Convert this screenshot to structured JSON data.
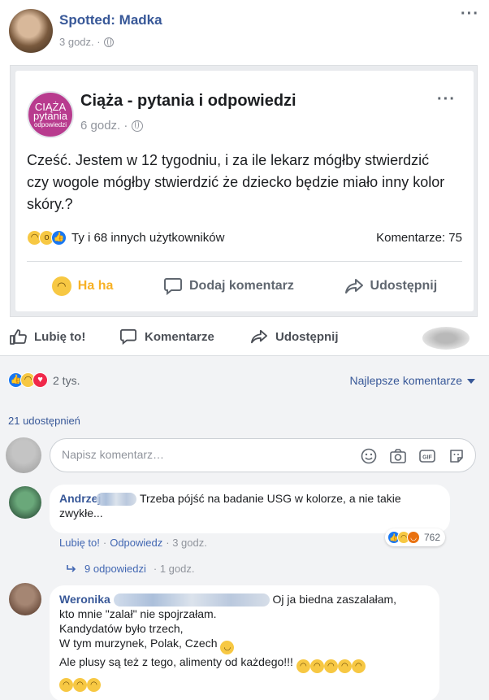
{
  "post": {
    "author": "Spotted: Madka",
    "time": "3 godz. ·",
    "menu_icon": "more-dots-icon"
  },
  "shared": {
    "group_avatar_lines": [
      "CIĄŻA",
      "pytania",
      "odpowiedzi"
    ],
    "group_name": "Ciąża - pytania i odpowiedzi",
    "time": "6 godz. ·",
    "question": "Cześć. Jestem w 12 tygodniu, i za ile lekarz mógłby stwierdzić czy wogole mógłby stwierdzić że dziecko będzie miało inny kolor skóry.?",
    "reactions_text": "Ty i 68 innych użytkowników",
    "comments_count": "Komentarze: 75",
    "actions": {
      "haha": "Ha ha",
      "comment": "Dodaj komentarz",
      "share": "Udostępnij"
    }
  },
  "actions": {
    "like": "Lubię to!",
    "comment": "Komentarze",
    "share": "Udostępnij"
  },
  "stats": {
    "reactions_count": "2 tys.",
    "sort_label": "Najlepsze komentarze",
    "shares": "21 udostępnień"
  },
  "composer": {
    "placeholder": "Napisz komentarz…"
  },
  "comments": [
    {
      "author": "Andrzej",
      "text": "Trzeba pójść na badanie USG w kolorze, a nie takie zwykłe...",
      "like_label": "Lubię to!",
      "reply_label": "Odpowiedz",
      "time": "· 3 godz.",
      "reactions_count": "762",
      "replies_label": "9 odpowiedzi",
      "replies_time": "· 1 godz."
    },
    {
      "author": "Weronika",
      "text_line1": "Oj ja biedna zaszalałam,",
      "text_line2": "kto mnie \"zalał\" nie spojrzałam.",
      "text_line3": "Kandydatów było trzech,",
      "text_line4": "W tym murzynek, Polak, Czech",
      "text_line5": "Ale plusy są też z tego, alimenty od każdego!!!"
    }
  ],
  "colors": {
    "link": "#385898",
    "haha": "#f7b125",
    "like_blue": "#1877f2",
    "love_red": "#f0284a"
  }
}
